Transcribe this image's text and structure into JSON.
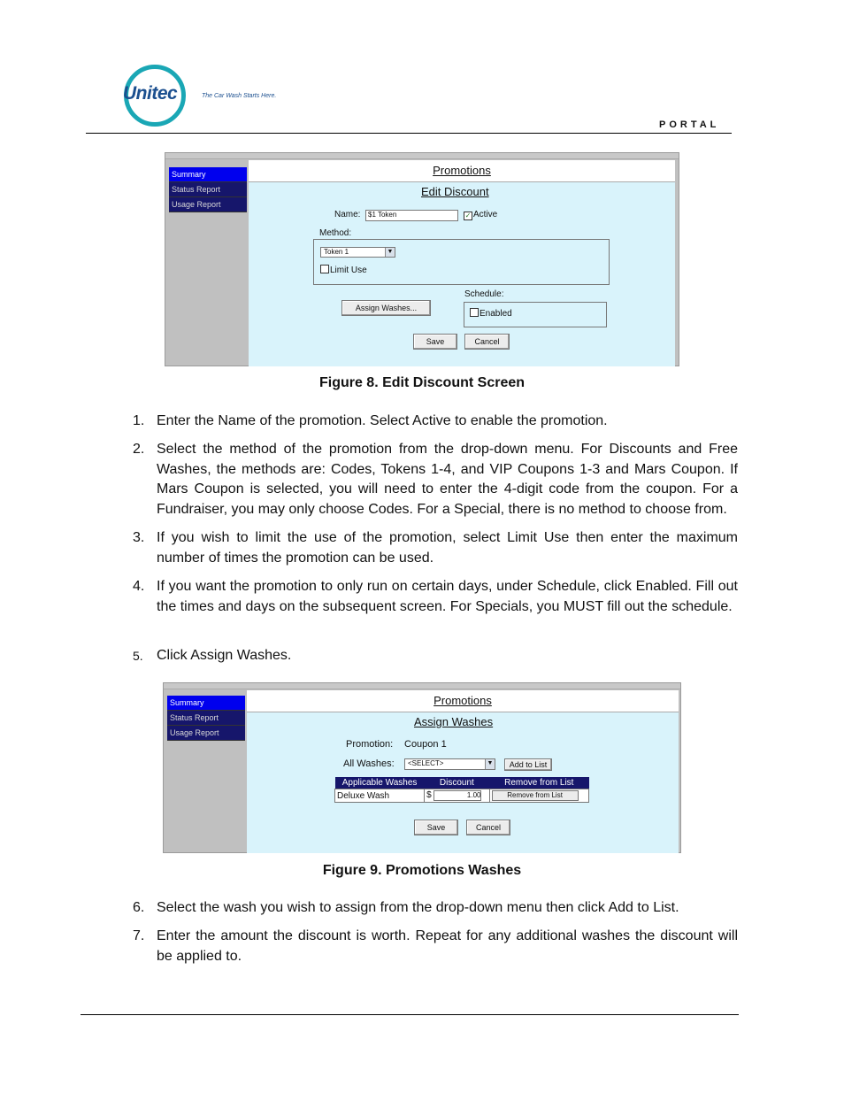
{
  "header": {
    "logo_text": "Unitec",
    "tagline": "The Car Wash Starts Here.",
    "section": "PORTAL"
  },
  "figure8": {
    "menu": [
      "Summary",
      "Status Report",
      "Usage Report"
    ],
    "title": "Promotions",
    "subtitle": "Edit Discount",
    "name_label": "Name:",
    "name_value": "$1 Token",
    "active_label": "Active",
    "method_label": "Method:",
    "method_value": "Token 1",
    "limit_use_label": "Limit Use",
    "assign_washes_button": "Assign Washes...",
    "schedule_label": "Schedule:",
    "enabled_label": "Enabled",
    "save_button": "Save",
    "cancel_button": "Cancel",
    "caption": "Figure 8. Edit Discount Screen"
  },
  "steps_a": [
    {
      "num": "1.",
      "text": "Enter the Name of the promotion. Select Active to enable the promotion."
    },
    {
      "num": "2.",
      "text": "Select the method of the promotion from the drop-down menu. For Discounts and Free Washes, the methods are: Codes, Tokens 1-4, and VIP Coupons 1-3 and Mars Coupon. If Mars Coupon is selected, you will need to enter the 4-digit code from the coupon. For a Fundraiser, you may only choose Codes. For a Special, there is no method to choose from."
    },
    {
      "num": "3.",
      "text": "If you wish to limit the use of the promotion, select Limit Use then enter the maximum number of times the promotion can be used."
    },
    {
      "num": "4.",
      "text": "If you want the promotion to only run on certain days, under Schedule, click Enabled. Fill out the times and days on the subsequent screen. For Specials, you MUST fill out the schedule."
    },
    {
      "num": "5.",
      "text": "Click Assign Washes."
    }
  ],
  "figure9": {
    "menu": [
      "Summary",
      "Status Report",
      "Usage Report"
    ],
    "title": "Promotions",
    "subtitle": "Assign Washes",
    "promotion_label": "Promotion:",
    "promotion_value": "Coupon 1",
    "all_washes_label": "All Washes:",
    "all_washes_value": "<SELECT>",
    "add_to_list_button": "Add to List",
    "table_headers": [
      "Applicable Washes",
      "Discount",
      "Remove from List"
    ],
    "row_wash": "Deluxe Wash",
    "row_currency": "$",
    "row_discount": "1.00",
    "row_remove_button": "Remove from List",
    "save_button": "Save",
    "cancel_button": "Cancel",
    "caption": "Figure 9. Promotions Washes"
  },
  "steps_b": [
    {
      "num": "6.",
      "text": "Select the wash you wish to assign from the drop-down menu then click Add to List."
    },
    {
      "num": "7.",
      "text": "Enter the amount the discount is worth. Repeat for any additional washes the discount will be applied to."
    }
  ]
}
